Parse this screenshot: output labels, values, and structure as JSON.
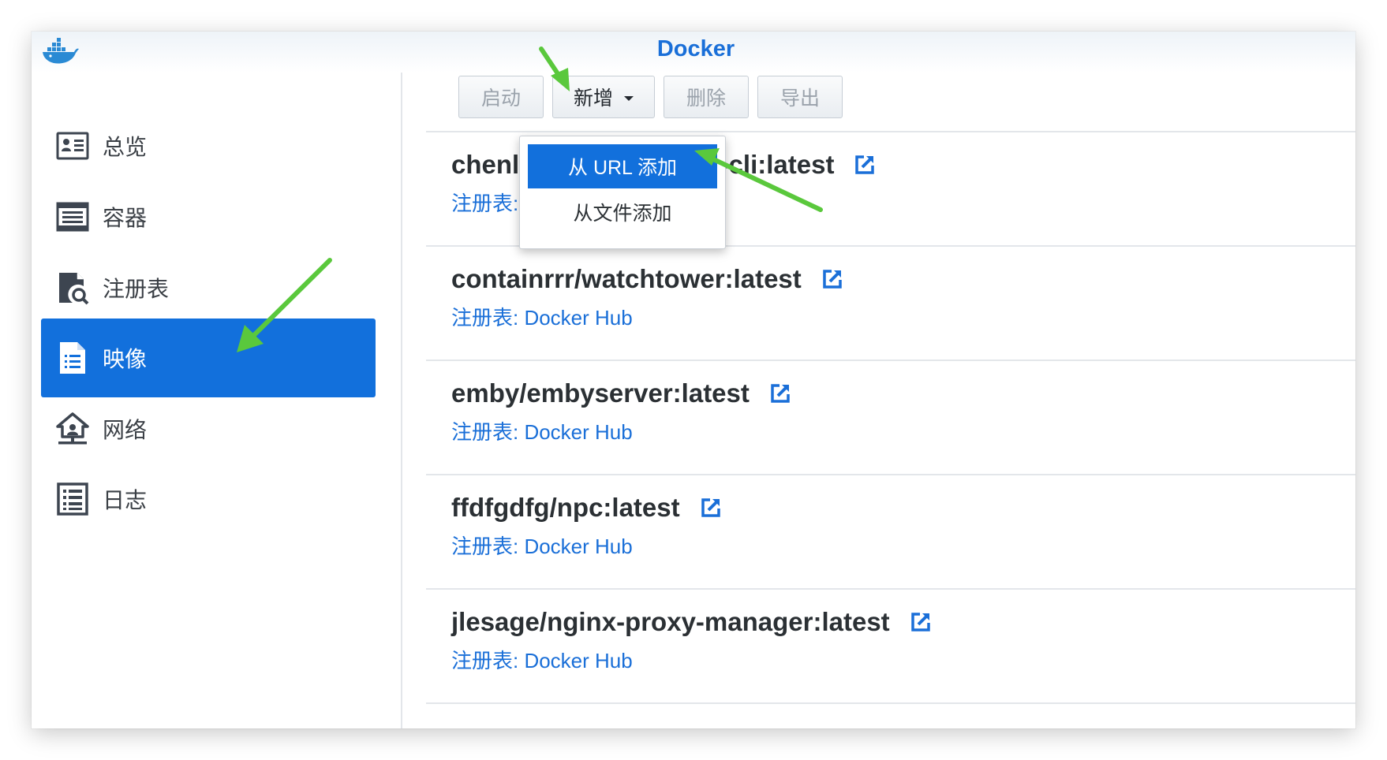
{
  "window": {
    "title": "Docker"
  },
  "sidebar": {
    "items": [
      {
        "label": "总览",
        "icon": "overview-icon",
        "active": false
      },
      {
        "label": "容器",
        "icon": "container-icon",
        "active": false
      },
      {
        "label": "注册表",
        "icon": "registry-icon",
        "active": false
      },
      {
        "label": "映像",
        "icon": "image-icon",
        "active": true
      },
      {
        "label": "网络",
        "icon": "network-icon",
        "active": false
      },
      {
        "label": "日志",
        "icon": "log-icon",
        "active": false
      }
    ]
  },
  "toolbar": {
    "start_label": "启动",
    "add_label": "新增",
    "delete_label": "删除",
    "export_label": "导出"
  },
  "add_menu": {
    "items": [
      {
        "label": "从 URL 添加",
        "selected": true
      },
      {
        "label": "从文件添加",
        "selected": false
      }
    ]
  },
  "images": [
    {
      "name": "chenl",
      "name_tail": "s-cli:latest",
      "registry": "注册表:"
    },
    {
      "name": "containrrr/watchtower:latest",
      "registry": "注册表: Docker Hub"
    },
    {
      "name": "emby/embyserver:latest",
      "registry": "注册表: Docker Hub"
    },
    {
      "name": "ffdfgdfg/npc:latest",
      "registry": "注册表: Docker Hub"
    },
    {
      "name": "jlesage/nginx-proxy-manager:latest",
      "registry": "注册表: Docker Hub"
    }
  ],
  "colors": {
    "accent": "#1270dc",
    "link": "#1a6fd8",
    "annotation_arrow": "#5ac83c"
  },
  "annotations": [
    "green-arrow-sidebar",
    "green-arrow-add-button",
    "green-arrow-url-item"
  ]
}
